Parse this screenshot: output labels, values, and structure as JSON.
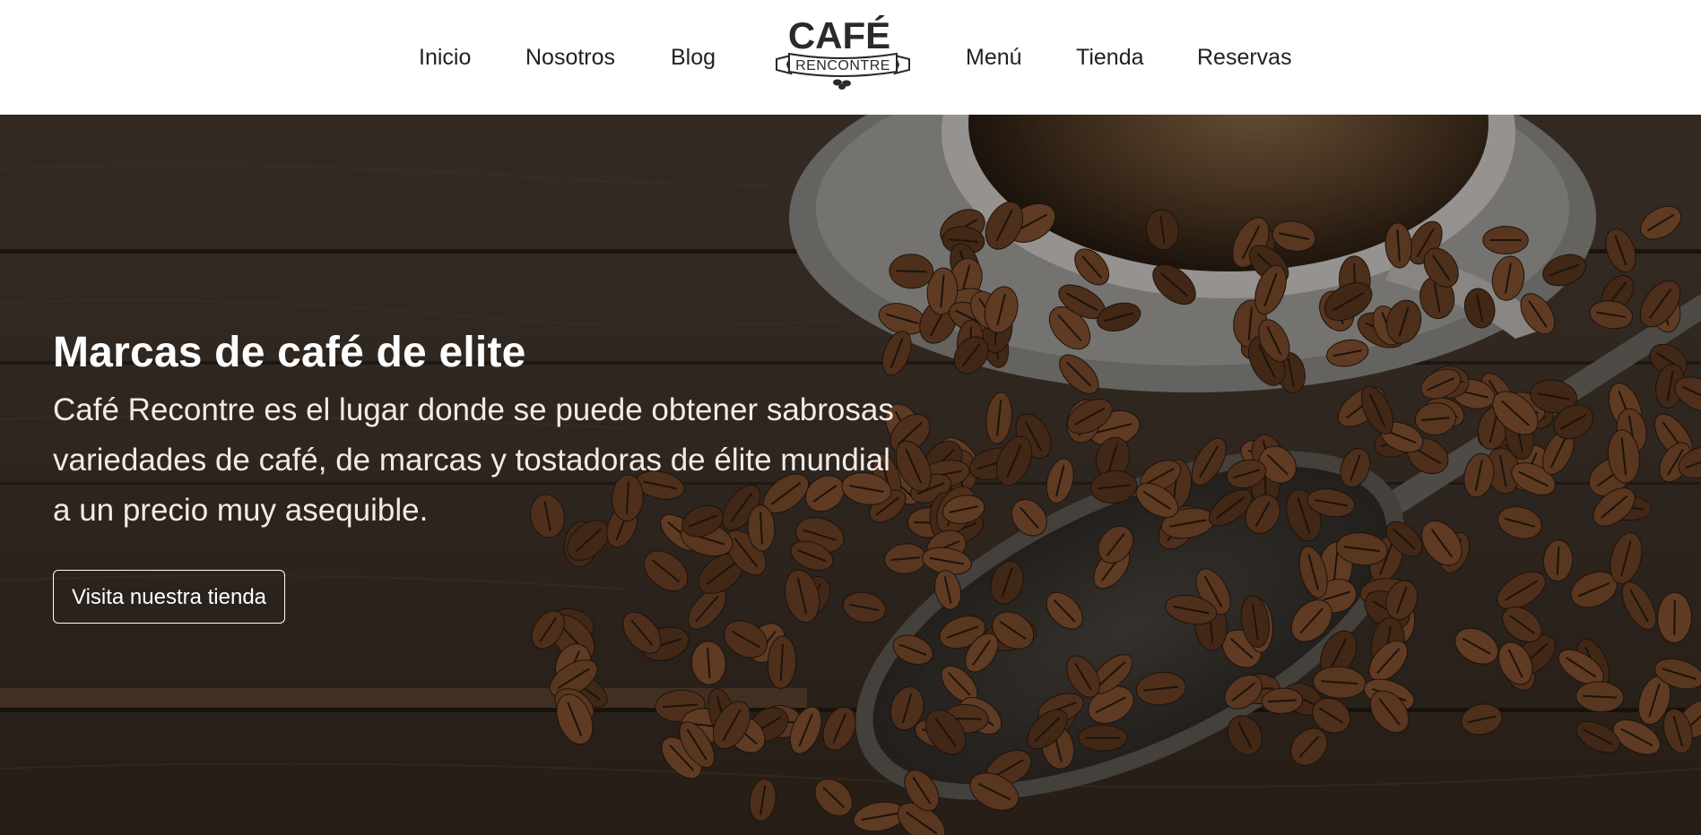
{
  "nav": {
    "left": [
      "Inicio",
      "Nosotros",
      "Blog"
    ],
    "right": [
      "Menú",
      "Tienda",
      "Reservas"
    ]
  },
  "logo": {
    "top_text": "CAFÉ",
    "ribbon_text": "RENCONTRE"
  },
  "hero": {
    "title": "Marcas de café de elite",
    "text": "Café Recontre es el lugar donde se puede obtener sabrosas variedades de café, de marcas y tostadoras de élite mundial a un precio muy asequible.",
    "button_label": "Visita nuestra tienda"
  },
  "colors": {
    "header_bg": "#ffffff",
    "nav_text": "#222222",
    "wood_dark": "#3a2e24",
    "bean": "#6b4226",
    "hero_text": "#ffffff"
  }
}
